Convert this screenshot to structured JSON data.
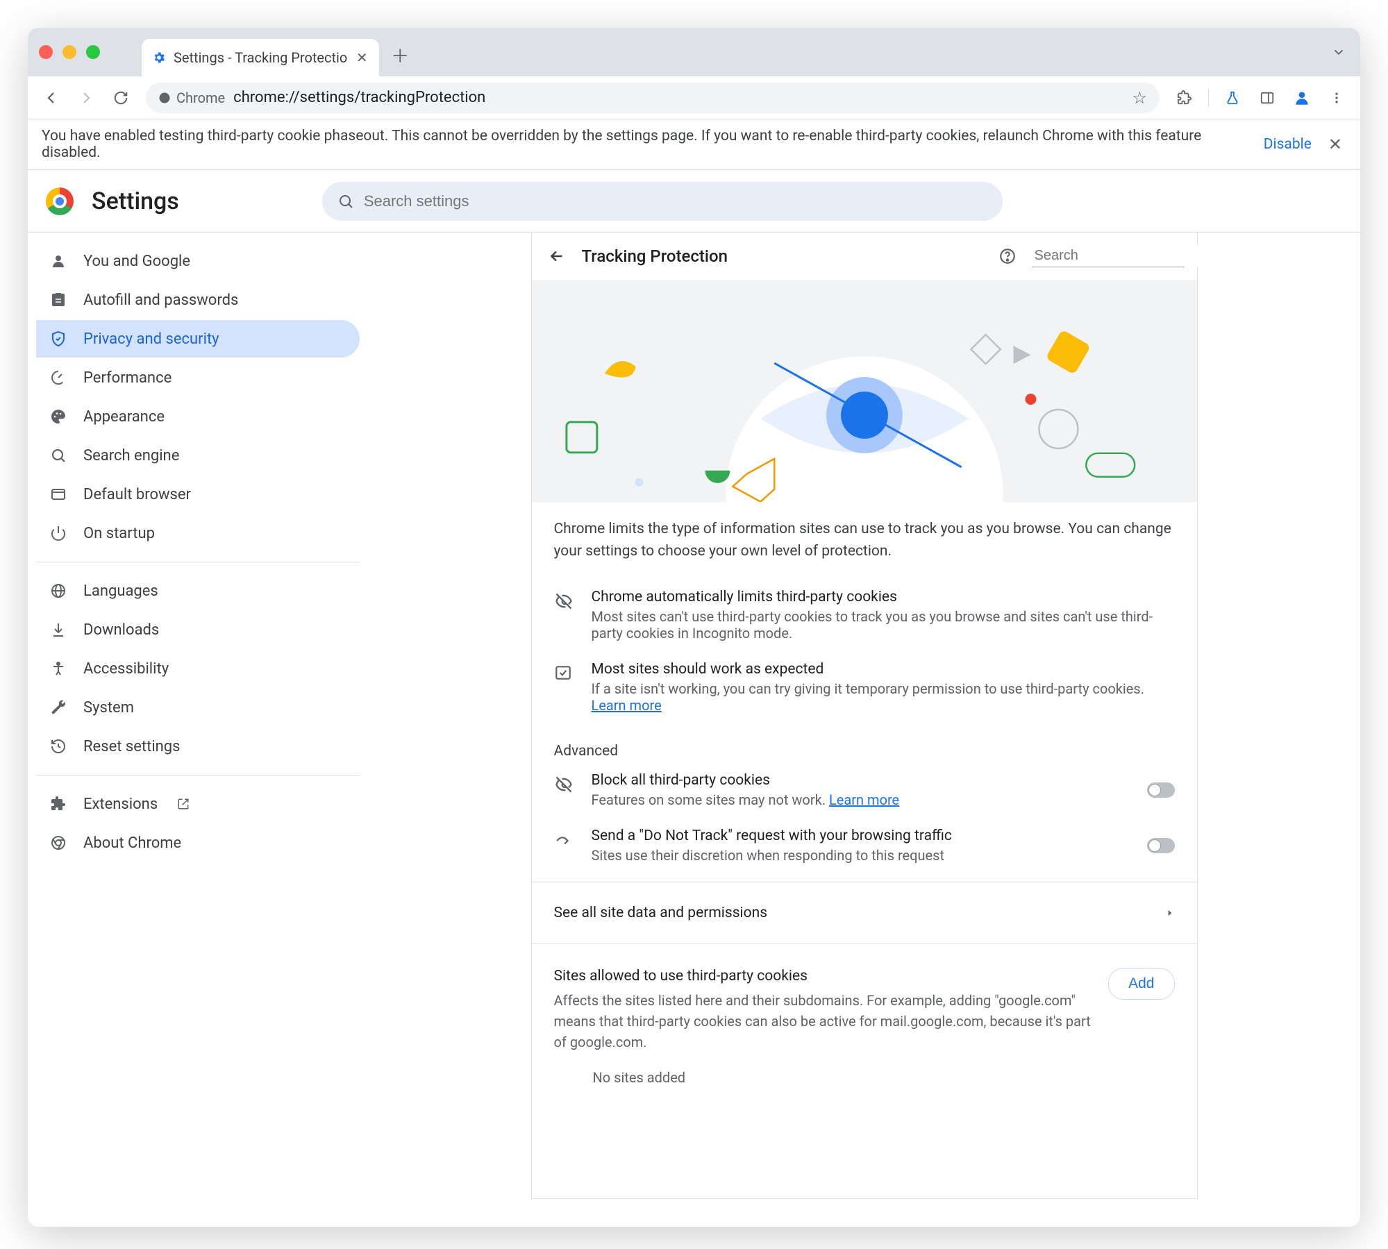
{
  "browser": {
    "tab_title": "Settings - Tracking Protectio",
    "url_chip": "Chrome",
    "url": "chrome://settings/trackingProtection"
  },
  "infobar": {
    "message": "You have enabled testing third-party cookie phaseout. This cannot be overridden by the settings page. If you want to re-enable third-party cookies, relaunch Chrome with this feature disabled.",
    "action": "Disable"
  },
  "settings": {
    "title": "Settings",
    "search_placeholder": "Search settings"
  },
  "sidebar": {
    "items": [
      {
        "id": "you",
        "label": "You and Google"
      },
      {
        "id": "autofill",
        "label": "Autofill and passwords"
      },
      {
        "id": "privacy",
        "label": "Privacy and security",
        "active": true
      },
      {
        "id": "perf",
        "label": "Performance"
      },
      {
        "id": "appearance",
        "label": "Appearance"
      },
      {
        "id": "search",
        "label": "Search engine"
      },
      {
        "id": "default",
        "label": "Default browser"
      },
      {
        "id": "startup",
        "label": "On startup"
      }
    ],
    "group2": [
      {
        "id": "lang",
        "label": "Languages"
      },
      {
        "id": "dl",
        "label": "Downloads"
      },
      {
        "id": "a11y",
        "label": "Accessibility"
      },
      {
        "id": "sys",
        "label": "System"
      },
      {
        "id": "reset",
        "label": "Reset settings"
      }
    ],
    "group3": [
      {
        "id": "ext",
        "label": "Extensions",
        "external": true
      },
      {
        "id": "about",
        "label": "About Chrome"
      }
    ]
  },
  "page": {
    "title": "Tracking Protection",
    "search_placeholder": "Search",
    "intro": "Chrome limits the type of information sites can use to track you as you browse. You can change your settings to choose your own level of protection.",
    "block1": {
      "title": "Chrome automatically limits third-party cookies",
      "desc": "Most sites can't use third-party cookies to track you as you browse and sites can't use third-party cookies in Incognito mode."
    },
    "block2": {
      "title": "Most sites should work as expected",
      "desc": "If a site isn't working, you can try giving it temporary permission to use third-party cookies.",
      "learn": "Learn more"
    },
    "advanced_label": "Advanced",
    "adv1": {
      "title": "Block all third-party cookies",
      "desc": "Features on some sites may not work. ",
      "learn": "Learn more"
    },
    "adv2": {
      "title": "Send a \"Do Not Track\" request with your browsing traffic",
      "desc": "Sites use their discretion when responding to this request"
    },
    "see_all": "See all site data and permissions",
    "allow": {
      "title": "Sites allowed to use third-party cookies",
      "desc": "Affects the sites listed here and their subdomains. For example, adding \"google.com\" means that third-party cookies can also be active for mail.google.com, because it's part of google.com.",
      "add": "Add",
      "empty": "No sites added"
    }
  }
}
